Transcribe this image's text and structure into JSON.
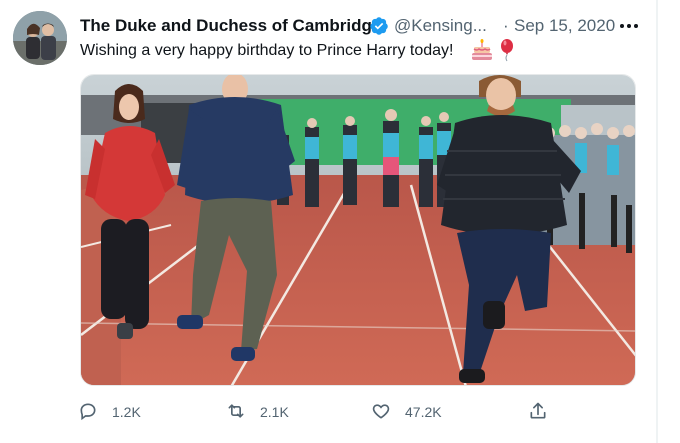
{
  "tweet": {
    "author_name": "The Duke and Duchess of Cambridge",
    "handle": "@Kensing...",
    "separator": "·",
    "date": "Sep 15, 2020",
    "text": "Wishing a very happy birthday to Prince Harry today!",
    "emojis": [
      "birthday-cake-icon",
      "balloon-icon"
    ]
  },
  "actions": {
    "replies": "1.2K",
    "retweets": "2.1K",
    "likes": "47.2K"
  },
  "colors": {
    "verified": "#1d9bf0",
    "secondary_text": "#536471",
    "track": "#c65a4a"
  }
}
